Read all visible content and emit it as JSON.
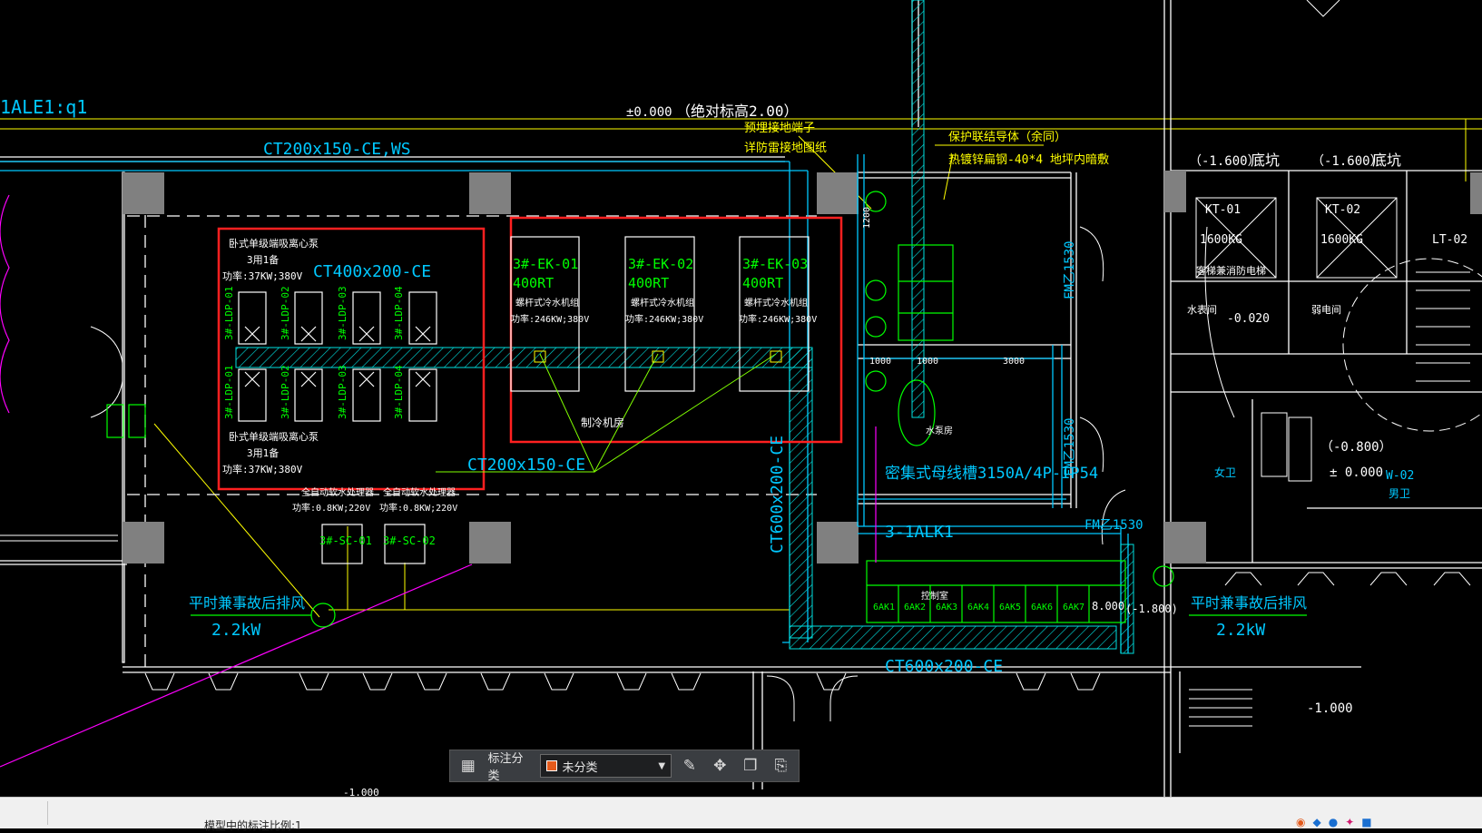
{
  "drawing": {
    "texts": {
      "layer_ref": "1ALE1:q1",
      "elev_zero": "±0.000",
      "abs_elev": "（绝对标高2.00）",
      "embedded_terminal": "预埋接地端子",
      "see_detail": "详防雷接地图纸",
      "protect_conductor": "保护联结导体（余同）",
      "galv_steel": "热镀锌扁钢-40*4 地坪内暗敷",
      "tray_top": "CT200x150-CE,WS",
      "tray_pumps": "CT400x200-CE",
      "tray_mid": "CT200x150-CE",
      "tray_vertical": "CT600x200-CE",
      "tray_bottom": "CT600x200-CE",
      "pump_title_top": "卧式单级端吸离心泵",
      "pump_count_top": "3用1备",
      "pump_power_top": "功率:37KW;380V",
      "pump_title_bottom": "卧式单级端吸离心泵",
      "pump_count_bottom": "3用1备",
      "pump_power_bottom": "功率:37KW;380V",
      "pump_tags_top": [
        "3#-LDP-01",
        "3#-LDP-02",
        "3#-LDP-03",
        "3#-LDP-04"
      ],
      "pump_tags_bottom": [
        "3#-LDP-01",
        "3#-LDP-02",
        "3#-LDP-03",
        "3#-LDP-04"
      ],
      "chillers": [
        {
          "tag": "3#-EK-01",
          "capacity": "400RT",
          "type": "螺杆式冷水机组",
          "power": "功率:246KW;380V"
        },
        {
          "tag": "3#-EK-02",
          "capacity": "400RT",
          "type": "螺杆式冷水机组",
          "power": "功率:246KW;380V"
        },
        {
          "tag": "3#-EK-03",
          "capacity": "400RT",
          "type": "螺杆式冷水机组",
          "power": "功率:246KW;380V"
        }
      ],
      "chiller_room": "制冷机房",
      "softener_1": "全自动软水处理器",
      "softener_2": "全自动软水处理器",
      "softener_power_1": "功率:0.8KW;220V",
      "softener_power_2": "功率:0.8KW;220V",
      "sc1": "3#-SC-01",
      "sc2": "3#-SC-02",
      "fan_left_title": "平时兼事故后排风",
      "fan_left_power": "2.2kW",
      "fan_right_title": "平时兼事故后排风",
      "fan_right_power": "2.2kW",
      "busway": "密集式母线槽3150A/4P-IP54",
      "panel": "3-1ALK1",
      "cabinets": [
        "6AK1",
        "6AK2",
        "6AK3",
        "6AK4",
        "6AK5",
        "6AK6",
        "6AK7",
        "8.000"
      ],
      "control_room": "控制室",
      "pit1_elev": "（-1.600）",
      "pit1": "底坑",
      "pit2_elev": "（-1.600）",
      "pit2": "底坑",
      "kt1": "KT-01",
      "kt2": "KT-02",
      "load1": "1600KG",
      "load2": "1600KG",
      "fire_elevator": "客梯兼消防电梯",
      "lt02": "LT-02",
      "elev_m0020": "-0.020",
      "elev_m0800": "（-0.800）",
      "elev_pm": "± 0.000",
      "elev_m1000": "-1.000",
      "elev_m1000b": "-1.000",
      "w02": "W-02",
      "male": "男卫",
      "female": "女卫",
      "door_fm1": "FM乙1530",
      "door_fm2": "FM乙1530",
      "door_fm3": "FM乙1530",
      "dim_1000a": "1000",
      "dim_1000b": "1000",
      "dim_3000": "3000",
      "weak_room": "弱电间",
      "water_room": "水表间",
      "pump_room_sm": "水泵房",
      "dim_1200": "1200",
      "elev_m1800": "(-1.800)"
    },
    "colors": {
      "wall": "#ffffff",
      "column": "#808080",
      "cyan": "#00c8ff",
      "green": "#00ff00",
      "yellow": "#ffff00",
      "red": "#ff2020",
      "magenta": "#ff00ff",
      "hatch": "#00e0e0"
    }
  },
  "toolbar": {
    "grid_icon": "grid-icon",
    "category_label": "标注分类",
    "category_value": "未分类",
    "category_color": "#e35a1c",
    "edit_icon": "edit-icon",
    "move_icon": "move-icon",
    "copy_icon": "copy-icon",
    "paste_icon": "paste-icon"
  },
  "statusbar": {
    "text": "模型中的标注比例:1"
  }
}
